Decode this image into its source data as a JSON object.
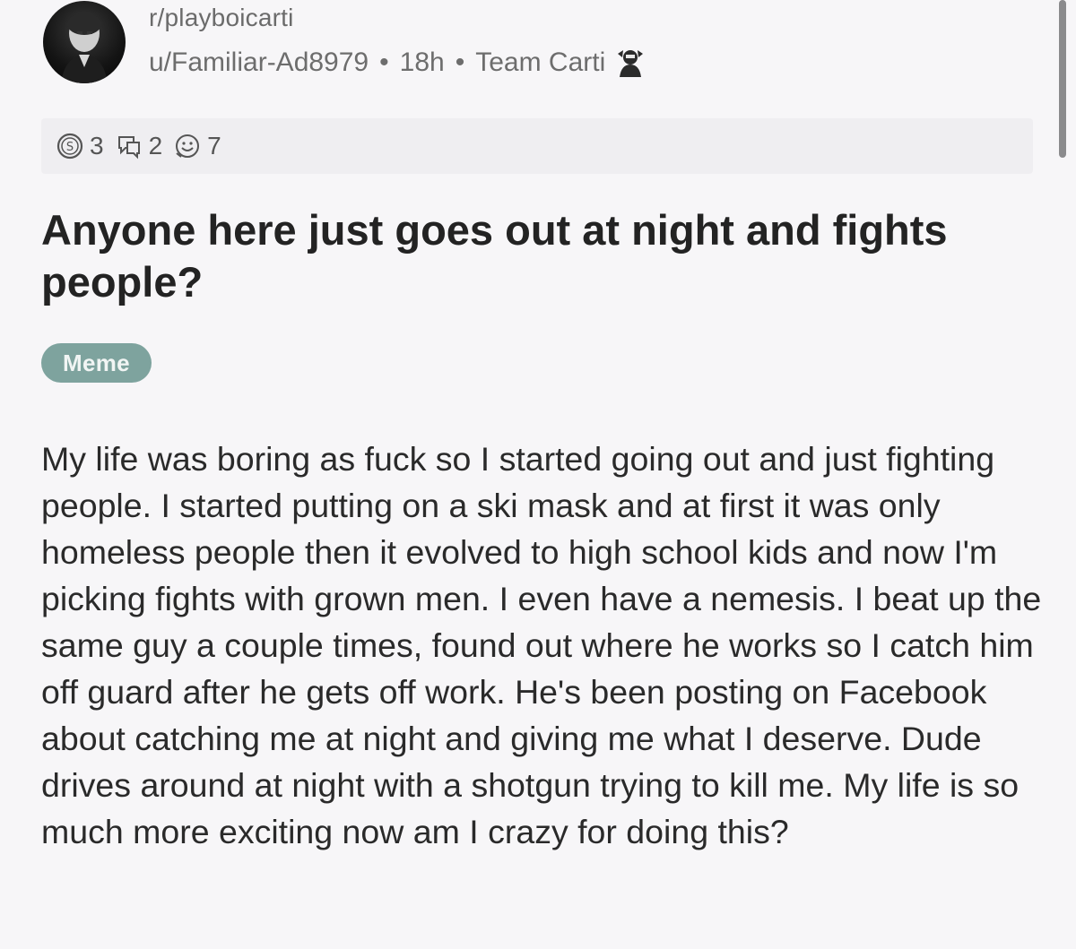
{
  "post": {
    "subreddit": "r/playboicarti",
    "author": "u/Familiar-Ad8979",
    "age": "18h",
    "user_flair": "Team Carti",
    "separator": "•",
    "awards": [
      {
        "icon": "silver-award-icon",
        "count": "3"
      },
      {
        "icon": "helpful-award-icon",
        "count": "2"
      },
      {
        "icon": "wholesome-award-icon",
        "count": "7"
      }
    ],
    "title": "Anyone here just goes out at night and fights people?",
    "post_flair": "Meme",
    "post_flair_color": "#7ea39e",
    "body": "My life was boring as fuck so I started going out and just fighting people. I started putting on a ski mask and at first it was only homeless people then it evolved to high school kids and now I'm picking fights with grown men. I even have a nemesis. I beat up the same guy a couple times, found out where he works so I catch him off guard after he gets off work. He's been posting on Facebook about catching me at night and giving me what I deserve. Dude drives around at night with a shotgun trying to kill me. My life is so much more exciting now am I crazy for doing this?"
  }
}
